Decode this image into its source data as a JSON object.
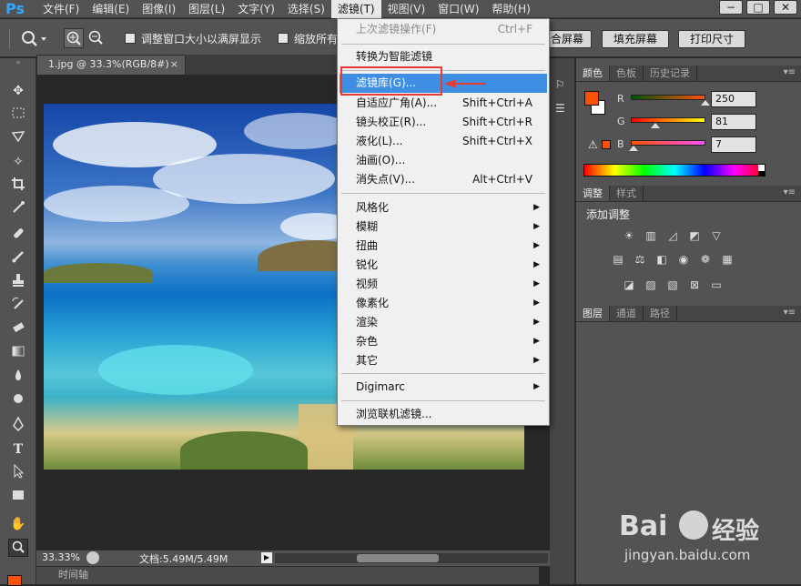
{
  "app": {
    "logo": "Ps"
  },
  "menubar": {
    "items": [
      "文件(F)",
      "编辑(E)",
      "图像(I)",
      "图层(L)",
      "文字(Y)",
      "选择(S)",
      "滤镜(T)",
      "视图(V)",
      "窗口(W)",
      "帮助(H)"
    ],
    "active_index": 6,
    "window_controls": [
      "−",
      "□",
      "✕"
    ]
  },
  "options_bar": {
    "checkbox1_label": "调整窗口大小以满屏显示",
    "checkbox2_label": "缩放所有",
    "btn_fit": "合屏幕",
    "btn_fill": "填充屏幕",
    "btn_print": "打印尺寸"
  },
  "document": {
    "tab_title": "1.jpg @ 33.3%(RGB/8#)",
    "tab_close": "×",
    "zoom": "33.33%",
    "doc_info": "文档:5.49M/5.49M"
  },
  "timeline": {
    "label": "时间轴"
  },
  "filter_menu": {
    "last_filter": {
      "label": "上次滤镜操作(F)",
      "shortcut": "Ctrl+F"
    },
    "smart": "转换为智能滤镜",
    "gallery": "滤镜库(G)...",
    "adaptive": {
      "label": "自适应广角(A)...",
      "shortcut": "Shift+Ctrl+A"
    },
    "lens": {
      "label": "镜头校正(R)...",
      "shortcut": "Shift+Ctrl+R"
    },
    "liquify": {
      "label": "液化(L)...",
      "shortcut": "Shift+Ctrl+X"
    },
    "oil": "油画(O)...",
    "vanish": {
      "label": "消失点(V)...",
      "shortcut": "Alt+Ctrl+V"
    },
    "submenus": [
      "风格化",
      "模糊",
      "扭曲",
      "锐化",
      "视频",
      "像素化",
      "渲染",
      "杂色",
      "其它"
    ],
    "digimarc": "Digimarc",
    "browse": "浏览联机滤镜..."
  },
  "color_panel": {
    "tabs": [
      "颜色",
      "色板",
      "历史记录"
    ],
    "r_label": "R",
    "g_label": "G",
    "b_label": "B",
    "r_value": "250",
    "g_value": "81",
    "b_value": "7",
    "fg_color": "#fa5107"
  },
  "adjust_panel": {
    "tabs": [
      "调整",
      "样式"
    ],
    "title": "添加调整"
  },
  "layers_panel": {
    "tabs": [
      "图层",
      "通道",
      "路径"
    ]
  },
  "watermark": {
    "brand": "Bai",
    "brand2": "经验",
    "url": "jingyan.baidu.com"
  }
}
